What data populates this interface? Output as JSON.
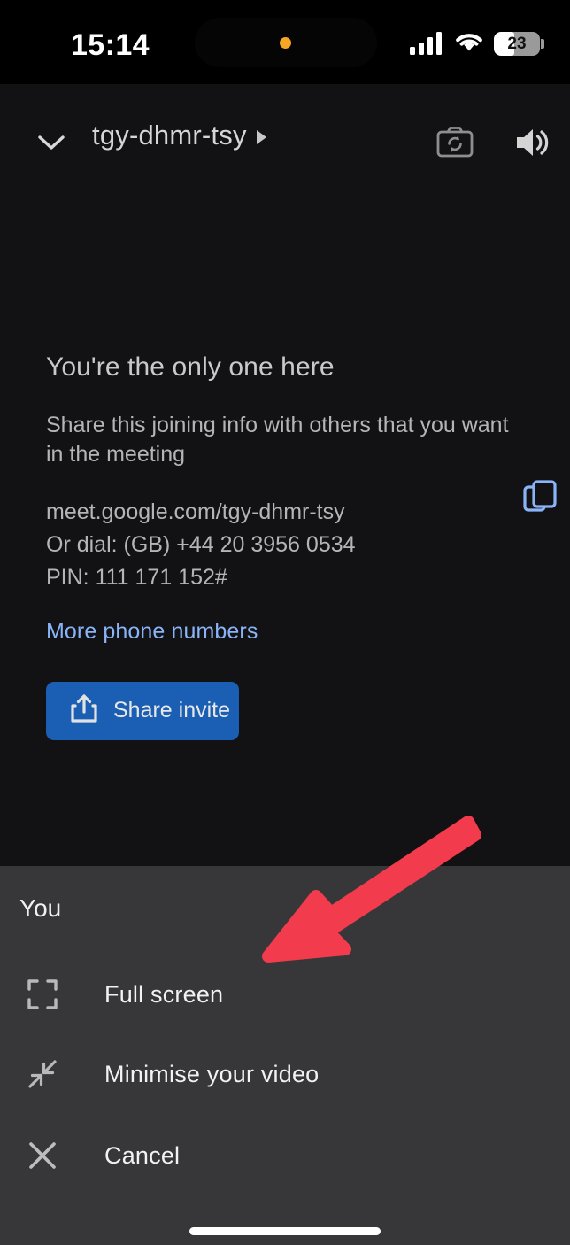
{
  "status_bar": {
    "time": "15:14",
    "battery_level": "23",
    "privacy_dot_color": "#F5A623",
    "signal_icon": "cellular-signal-icon",
    "wifi_icon": "wifi-icon",
    "battery_icon": "battery-icon"
  },
  "header": {
    "collapse_icon": "chevron-down-icon",
    "meeting_code": "tgy-dhmr-tsy",
    "meeting_code_caret_icon": "caret-right-icon",
    "camera_switch_icon": "camera-switch-icon",
    "speaker_icon": "speaker-volume-icon"
  },
  "main": {
    "title": "You're the only one here",
    "subtitle": "Share this joining info with others that you want in the meeting",
    "meeting_link": "meet.google.com/tgy-dhmr-tsy",
    "dial_in": "Or dial: (GB) +44 20 3956 0534",
    "pin": "PIN: 111 171 152#",
    "copy_icon": "copy-icon",
    "more_phone_numbers": "More phone numbers",
    "share_invite_label": "Share invite",
    "share_icon": "share-upload-icon",
    "share_button_color": "#1A5FB4",
    "link_color": "#8AB4F8"
  },
  "bottom_sheet": {
    "title": "You",
    "items": [
      {
        "label": "Full screen",
        "icon": "fullscreen-expand-icon"
      },
      {
        "label": "Minimise your video",
        "icon": "collapse-arrows-icon"
      },
      {
        "label": "Cancel",
        "icon": "close-x-icon"
      }
    ],
    "background_color": "#37373A"
  },
  "annotation": {
    "arrow_color": "#F23B4C",
    "points_to": "Full screen"
  }
}
